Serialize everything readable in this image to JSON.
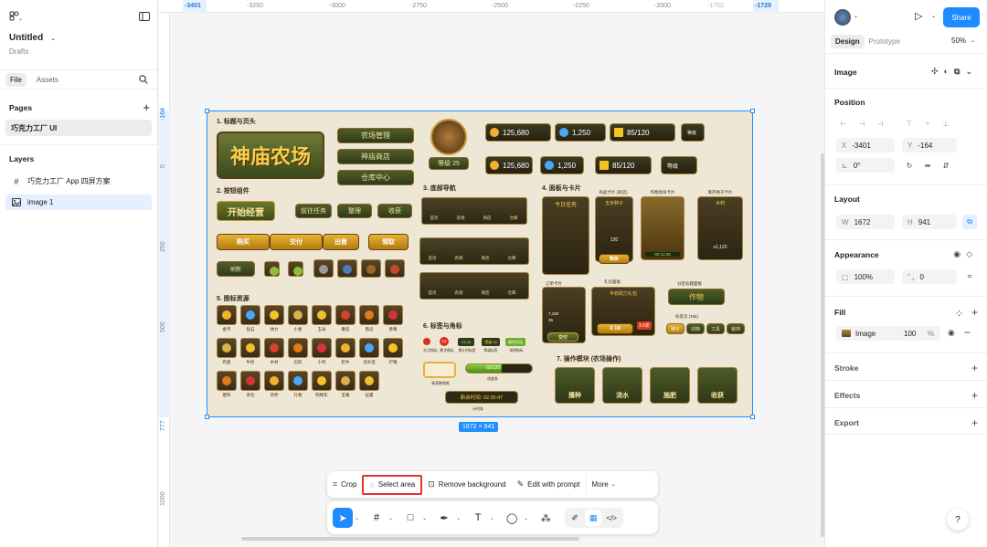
{
  "file": {
    "title": "Untitled",
    "location": "Drafts"
  },
  "left_tabs": [
    "File",
    "Assets"
  ],
  "pages": {
    "header": "Pages",
    "items": [
      "巧克力工厂 UI"
    ]
  },
  "layers": {
    "header": "Layers",
    "items": [
      "巧克力工厂 App 四屏方案",
      "image 1"
    ]
  },
  "rulers": {
    "top": [
      "-3401",
      "-3250",
      "-3000",
      "-2750",
      "-2500",
      "-2250",
      "-2000",
      "-1750",
      "-1729"
    ],
    "left": [
      "-164",
      "0",
      "250",
      "500",
      "777",
      "1000"
    ]
  },
  "canvas": {
    "size_badge": "1672 × 941",
    "art": {
      "sec1": "1. 标题与页头",
      "logo": "神庙农场",
      "menu": [
        "农场管理",
        "神庙商店",
        "仓库中心"
      ],
      "level": "等级 25",
      "stats": [
        "125,680",
        "1,250",
        "85/120"
      ],
      "stat_labels": [
        "金币",
        "钻石",
        "体力",
        "等级"
      ],
      "sec2": "2. 按钮组件",
      "start_btn": "开始经营",
      "small_btns": [
        "前往任务",
        "整理",
        "收获"
      ],
      "yellow_btns": [
        "购买",
        "交付",
        "出售",
        "领取"
      ],
      "refresh": "刷新",
      "sec3": "3. 底部导航",
      "nav": [
        "首页",
        "农场",
        "商店",
        "仓库"
      ],
      "sec4": "4. 面板与卡片",
      "card_titles": [
        "今日任务",
        "商品卡片 (商店)",
        "作物地块卡片",
        "库存格子卡片"
      ],
      "seed_name": "玉米种子",
      "seed_price": "120",
      "buy": "购买",
      "timer_small": "00:12:35",
      "wood": "木材",
      "wood_price": "x1,120",
      "order_card": "订单卡片",
      "gift_panel": "礼包面板",
      "gift_title": "丰收助力礼包",
      "gift_price": "¥ 18",
      "gift_discount": "3.5折",
      "partition": "分区标题面板",
      "partition_title": "作物",
      "tabs_label": "标签页 (Tab)",
      "tabs": [
        "种子",
        "动物",
        "工具",
        "装饰"
      ],
      "order_values": [
        "7,150",
        "35"
      ],
      "deliver": "交付",
      "sec5": "5. 图标资源",
      "icons_row1": [
        "金币",
        "钻石",
        "体力",
        "小麦",
        "玉米",
        "番茄",
        "南瓜",
        "草莓"
      ],
      "icons_row2": [
        "鸡蛋",
        "牛奶",
        "木材",
        "石料",
        "小鸡",
        "奶牛",
        "浇水壶",
        "铲锹"
      ],
      "icons_row3": [
        "肥料",
        "背包",
        "奖杯",
        "礼物",
        "购物车",
        "宝箱",
        "设置"
      ],
      "sec6": "6. 标签与角标",
      "badge_labels": [
        "红点角标",
        "数字角标",
        "倒计时标签",
        "等级标签",
        "说明角标"
      ],
      "badge_values": [
        "12",
        "03:35",
        "等级 25",
        "限时活动"
      ],
      "progress": "65/120",
      "progress_label": "进度条",
      "empty_label": "高亮聚焦框",
      "timer": "新余时间: 02:35:47",
      "timer_label": "计时条",
      "sec7": "7. 操作模块 (农场操作)",
      "actions": [
        "播种",
        "浇水",
        "施肥",
        "收获"
      ]
    }
  },
  "context_toolbar": {
    "items": [
      "Crop",
      "Select area",
      "Remove background",
      "Edit with prompt",
      "More"
    ]
  },
  "right": {
    "share": "Share",
    "tabs": [
      "Design",
      "Prototype"
    ],
    "zoom": "50%",
    "layer_type": "Image",
    "position": {
      "header": "Position",
      "x": "-3401",
      "y": "-164",
      "rotation": "0°"
    },
    "layout": {
      "header": "Layout",
      "w": "1672",
      "h": "941"
    },
    "appearance": {
      "header": "Appearance",
      "opacity": "100%",
      "radius": "0"
    },
    "fill": {
      "header": "Fill",
      "type": "Image",
      "opacity": "100",
      "unit": "%"
    },
    "stroke": "Stroke",
    "effects": "Effects",
    "export": "Export"
  },
  "colors": {
    "accent": "#1e8bff",
    "highlight": "#e0342f"
  }
}
